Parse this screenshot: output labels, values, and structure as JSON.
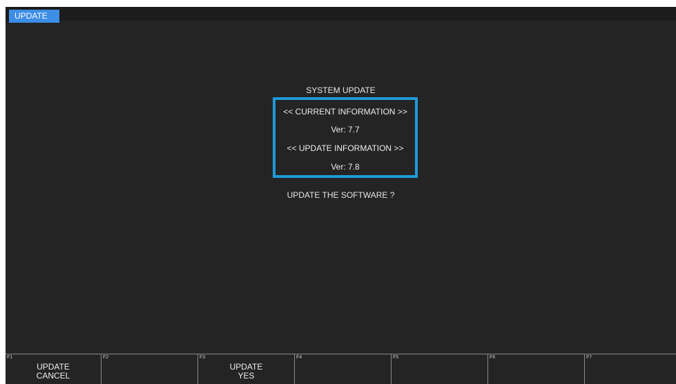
{
  "tab": {
    "label": "UPDATE"
  },
  "dialog": {
    "title": "SYSTEM UPDATE",
    "current_header": "<< CURRENT INFORMATION >>",
    "current_version": "Ver: 7.7",
    "update_header": "<< UPDATE INFORMATION >>",
    "update_version": "Ver: 7.8",
    "prompt": "UPDATE THE SOFTWARE ?"
  },
  "colors": {
    "accent_tab": "#3d8ee6",
    "box_border": "#1e9ad8",
    "background": "#242424"
  },
  "function_keys": [
    {
      "num": "F1",
      "line1": "UPDATE",
      "line2": "CANCEL"
    },
    {
      "num": "F2",
      "line1": "",
      "line2": ""
    },
    {
      "num": "F3",
      "line1": "UPDATE",
      "line2": "YES"
    },
    {
      "num": "F4",
      "line1": "",
      "line2": ""
    },
    {
      "num": "F5",
      "line1": "",
      "line2": ""
    },
    {
      "num": "F6",
      "line1": "",
      "line2": ""
    },
    {
      "num": "F7",
      "line1": "",
      "line2": ""
    }
  ]
}
